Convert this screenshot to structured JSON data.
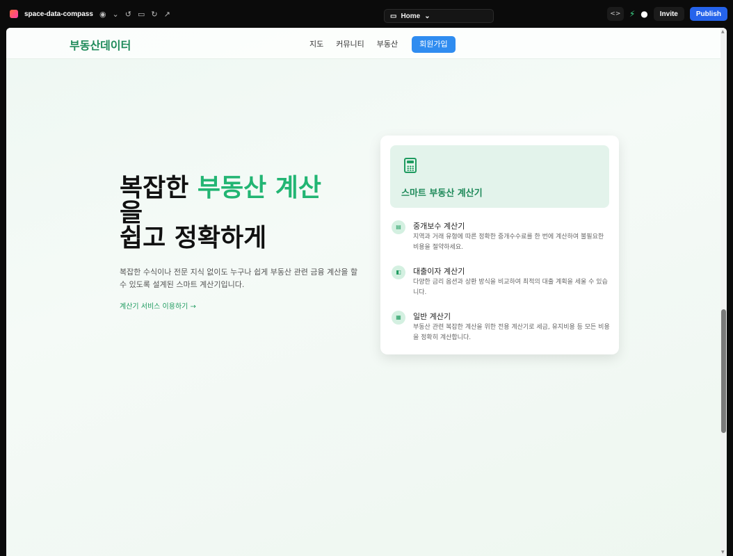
{
  "browser": {
    "project_name": "space-data-compass",
    "route_label": "Home",
    "invite_label": "Invite",
    "publish_label": "Publish"
  },
  "site": {
    "logo": "부동산데이터",
    "nav": [
      "지도",
      "커뮤니티",
      "부동산"
    ],
    "signup_label": "회원가입"
  },
  "hero": {
    "title_prefix": "복잡한 ",
    "title_accent": "부동산 계산",
    "title_line2": "을",
    "title_line3": "쉽고 정확하게",
    "description": "복잡한 수식이나 전문 지식 없이도 누구나 쉽게 부동산 관련 금융 계산을 할 수 있도록 설계된 스마트 계산기입니다.",
    "cta": "계산기 서비스 이용하기 →"
  },
  "card": {
    "title": "스마트 부동산 계산기",
    "features": [
      {
        "icon": "receipt-icon",
        "title": "중개보수 계산기",
        "desc": "지역과 거래 유형에 따른 정확한 중개수수료를 한 번에 계산하여 불필요한 비용을 절약하세요."
      },
      {
        "icon": "loan-icon",
        "title": "대출이자 계산기",
        "desc": "다양한 금리 옵션과 상환 방식을 비교하여 최적의 대출 계획을 세울 수 있습니다."
      },
      {
        "icon": "calculator-icon",
        "title": "일반 계산기",
        "desc": "부동산 관련 복잡한 계산을 위한 전용 계산기로 세금, 유지비용 등 모든 비용을 정확히 계산합니다."
      }
    ]
  },
  "colors": {
    "accent": "#22b573",
    "brand": "#1f8a5a",
    "signup": "#2f8cf0",
    "publish": "#2563eb"
  }
}
